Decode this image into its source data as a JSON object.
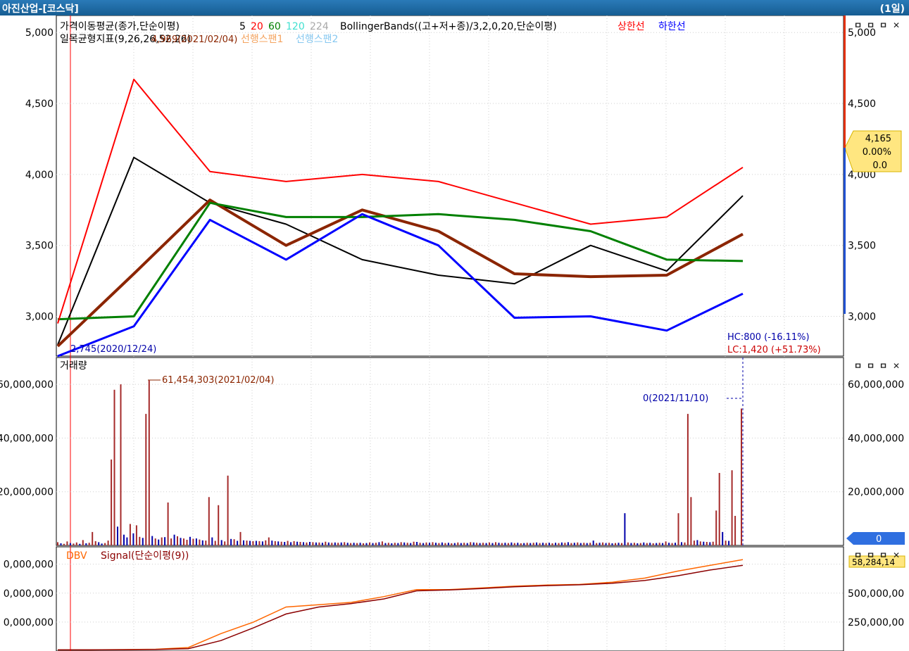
{
  "window": {
    "title": "아진산업-[코스닥]",
    "period": "(1일)"
  },
  "panel_buttons": [
    "ㅁ",
    "ㅁ",
    "ㅁ",
    "✕"
  ],
  "colors": {
    "ma5": "#000000",
    "ma20": "#8b2500",
    "ma60": "#008000",
    "ma120": "#40e0d0",
    "ma224": "#a9a9a9",
    "bb_upper": "#ff0000",
    "bb_lower": "#0000ff",
    "span1": "#f4a460",
    "span2": "#87c8f0",
    "volume_up": "#a52a2a",
    "volume_down": "#0000aa",
    "dbv": "#ff6600",
    "signal": "#8b0000"
  },
  "legend": {
    "ma_label": "가격이동평균(종가,단순이평)",
    "ma_periods": [
      "5",
      "20",
      "60",
      "120",
      "224"
    ],
    "bb_label": "BollingerBands((고+저+종)/3,2,0,20,단순이평)",
    "bb_upper": "상한선",
    "bb_lower": "하한선",
    "ichimoku_label": "일목균형지표(9,26,26,52,26)",
    "span1": "선행스팬1",
    "span2": "선행스팬2"
  },
  "chart_data": [
    {
      "type": "line",
      "panel": "price",
      "ylim": [
        2720,
        5120
      ],
      "yticks": [
        "5,000",
        "4,500",
        "4,000",
        "3,500",
        "3,000"
      ],
      "ytick_values": [
        5000,
        4500,
        4000,
        3500,
        3000
      ],
      "x": [
        "2020/12/24",
        "2021/02/04",
        "2021/11/10"
      ],
      "series": [
        {
          "name": "5",
          "values": [
            2800,
            4120,
            3800,
            3650,
            3400,
            3290,
            3230,
            3500,
            3320,
            3850
          ]
        },
        {
          "name": "20",
          "values": [
            2790,
            3300,
            3820,
            3500,
            3750,
            3600,
            3300,
            3280,
            3290,
            3580
          ]
        },
        {
          "name": "60",
          "values": [
            2980,
            3000,
            3800,
            3700,
            3700,
            3720,
            3680,
            3600,
            3400,
            3390
          ]
        },
        {
          "name": "상한선",
          "values": [
            2950,
            4670,
            4020,
            3950,
            4000,
            3950,
            3800,
            3650,
            3700,
            4050
          ]
        },
        {
          "name": "하한선",
          "values": [
            2720,
            2930,
            3680,
            3400,
            3720,
            3500,
            2990,
            3000,
            2900,
            3160
          ]
        }
      ],
      "annotations": {
        "high_marker": "4,969(2021/02/04)",
        "low_marker": "2,745(2020/12/24)",
        "hc": "HC:800 (-16.11%)",
        "lc": "LC:1,420 (+51.73%)"
      },
      "current": {
        "price": "4,165",
        "change_pct": "0.00%",
        "change": "0.0"
      }
    },
    {
      "type": "bar",
      "panel": "volume",
      "title": "거래량",
      "ylim": [
        0,
        70000000
      ],
      "yticks": [
        "60,000,000",
        "40,000,000",
        "20,000,000"
      ],
      "ytick_values": [
        60000000,
        40000000,
        20000000
      ],
      "values": [
        1200000,
        800000,
        600000,
        1500000,
        900000,
        700000,
        1100000,
        600000,
        2000000,
        800000,
        1000000,
        5000000,
        1600000,
        1200000,
        700000,
        900000,
        1800000,
        32000000,
        58000000,
        7000000,
        60000000,
        4000000,
        3000000,
        8000000,
        4500000,
        7500000,
        3200000,
        2800000,
        49000000,
        61454303,
        3500000,
        2600000,
        2200000,
        3000000,
        3100000,
        16000000,
        2600000,
        4000000,
        3400000,
        2800000,
        2600000,
        2100000,
        3200000,
        2500000,
        2600000,
        2200000,
        1900000,
        1800000,
        18000000,
        3000000,
        1700000,
        15000000,
        2000000,
        1500000,
        26000000,
        2400000,
        2300000,
        1700000,
        5000000,
        1900000,
        1800000,
        1700000,
        1600000,
        1700000,
        1600000,
        1500000,
        1900000,
        3000000,
        1800000,
        1600000,
        1500000,
        1400000,
        1300000,
        1700000,
        1200000,
        1600000,
        1400000,
        1300000,
        1200000,
        1100000,
        1300000,
        1200000,
        1100000,
        1100000,
        1000000,
        1400000,
        1100000,
        1000000,
        1100000,
        1000000,
        1100000,
        1200000,
        1000000,
        900000,
        1000000,
        900000,
        1000000,
        800000,
        900000,
        1100000,
        900000,
        1000000,
        1200000,
        1500000,
        900000,
        1000000,
        800000,
        1000000,
        900000,
        1200000,
        1100000,
        1000000,
        900000,
        1400000,
        1300000,
        1000000,
        900000,
        1100000,
        1000000,
        1200000,
        1000000,
        900000,
        1100000,
        900000,
        1000000,
        800000,
        900000,
        1100000,
        900000,
        1000000,
        900000,
        1200000,
        1100000,
        1000000,
        900000,
        1000000,
        900000,
        1100000,
        900000,
        1200000,
        1000000,
        900000,
        1000000,
        900000,
        1100000,
        900000,
        1000000,
        800000,
        900000,
        1000000,
        900000,
        1000000,
        1100000,
        900000,
        1000000,
        900000,
        1000000,
        800000,
        1000000,
        900000,
        1100000,
        1000000,
        1200000,
        900000,
        1000000,
        1100000,
        900000,
        1000000,
        900000,
        1000000,
        1800000,
        900000,
        1000000,
        1100000,
        900000,
        1000000,
        800000,
        900000,
        1000000,
        900000,
        12000000,
        1100000,
        900000,
        1000000,
        800000,
        900000,
        1100000,
        900000,
        1000000,
        800000,
        900000,
        1000000,
        900000,
        1500000,
        1000000,
        900000,
        1000000,
        12000000,
        1200000,
        1100000,
        49000000,
        18000000,
        1800000,
        2000000,
        1500000,
        1400000,
        1300000,
        1200000,
        1400000,
        13000000,
        27000000,
        5000000,
        1800000,
        1700000,
        28000000,
        11000000,
        0,
        51000000
      ],
      "up": [
        1,
        0,
        1,
        1,
        0,
        1,
        1,
        0,
        1,
        0,
        1,
        1,
        1,
        0,
        0,
        1,
        1,
        1,
        1,
        0,
        1,
        0,
        0,
        1,
        0,
        1,
        1,
        0,
        1,
        1,
        0,
        1,
        0,
        1,
        0,
        1,
        1,
        0,
        1,
        0,
        1,
        1,
        0,
        1,
        0,
        1,
        0,
        1,
        1,
        0,
        1,
        1,
        0,
        1,
        1,
        0,
        1,
        0,
        1,
        0,
        1,
        0,
        1,
        0,
        1,
        0,
        1,
        1,
        0,
        1,
        0,
        1,
        0,
        1,
        0,
        1,
        0,
        1,
        0,
        1,
        0,
        1,
        0,
        1,
        0,
        1,
        0,
        1,
        0,
        1,
        0,
        1,
        0,
        1,
        0,
        1,
        0,
        1,
        0,
        1,
        0,
        1,
        0,
        1,
        0,
        1,
        0,
        1,
        0,
        1,
        0,
        1,
        0,
        1,
        0,
        1,
        0,
        1,
        0,
        1,
        0,
        1,
        0,
        1,
        0,
        1,
        0,
        1,
        0,
        1,
        0,
        1,
        0,
        1,
        0,
        1,
        0,
        1,
        0,
        1,
        0,
        1,
        0,
        1,
        0,
        1,
        0,
        1,
        0,
        1,
        0,
        1,
        0,
        1,
        0,
        1,
        0,
        1,
        0,
        1,
        0,
        1,
        0,
        1,
        0,
        1,
        0,
        1,
        0,
        1,
        0,
        1,
        0,
        1,
        0,
        1,
        0,
        1,
        0,
        1,
        0,
        1,
        0,
        1,
        0,
        1,
        0,
        1,
        0,
        1,
        0,
        1,
        0,
        1,
        0,
        1,
        0,
        1,
        0,
        1,
        1,
        1,
        1,
        0,
        1,
        0,
        1,
        0,
        1,
        1,
        1,
        0,
        1,
        0,
        1,
        1,
        0,
        1
      ],
      "annotations": {
        "max_marker": "61,454,303(2021/02/04)",
        "last_marker": "0(2021/11/10)"
      },
      "current": "0"
    },
    {
      "type": "line",
      "panel": "dbv",
      "title": "DBV",
      "signal_label": "Signal(단순이평(9))",
      "ylim": [
        0,
        900000000
      ],
      "yticks_left": [
        "0,000,000",
        "0,000,000",
        "0,000,000"
      ],
      "yticks_right": [
        "500,000,00",
        "250,000,00"
      ],
      "ytick_values": [
        750000000,
        500000000,
        250000000
      ],
      "series": [
        {
          "name": "DBV",
          "values": [
            10000000,
            10000000,
            12000000,
            15000000,
            30000000,
            150000000,
            250000000,
            380000000,
            400000000,
            420000000,
            470000000,
            530000000,
            530000000,
            545000000,
            560000000,
            570000000,
            575000000,
            595000000,
            630000000,
            690000000,
            740000000,
            790000000
          ]
        },
        {
          "name": "Signal(단순이평(9))",
          "values": [
            10000000,
            10000000,
            11000000,
            13000000,
            20000000,
            90000000,
            200000000,
            320000000,
            380000000,
            410000000,
            450000000,
            520000000,
            528000000,
            540000000,
            555000000,
            565000000,
            572000000,
            585000000,
            610000000,
            650000000,
            700000000,
            740000000
          ]
        }
      ],
      "current": "58,284,14"
    }
  ]
}
